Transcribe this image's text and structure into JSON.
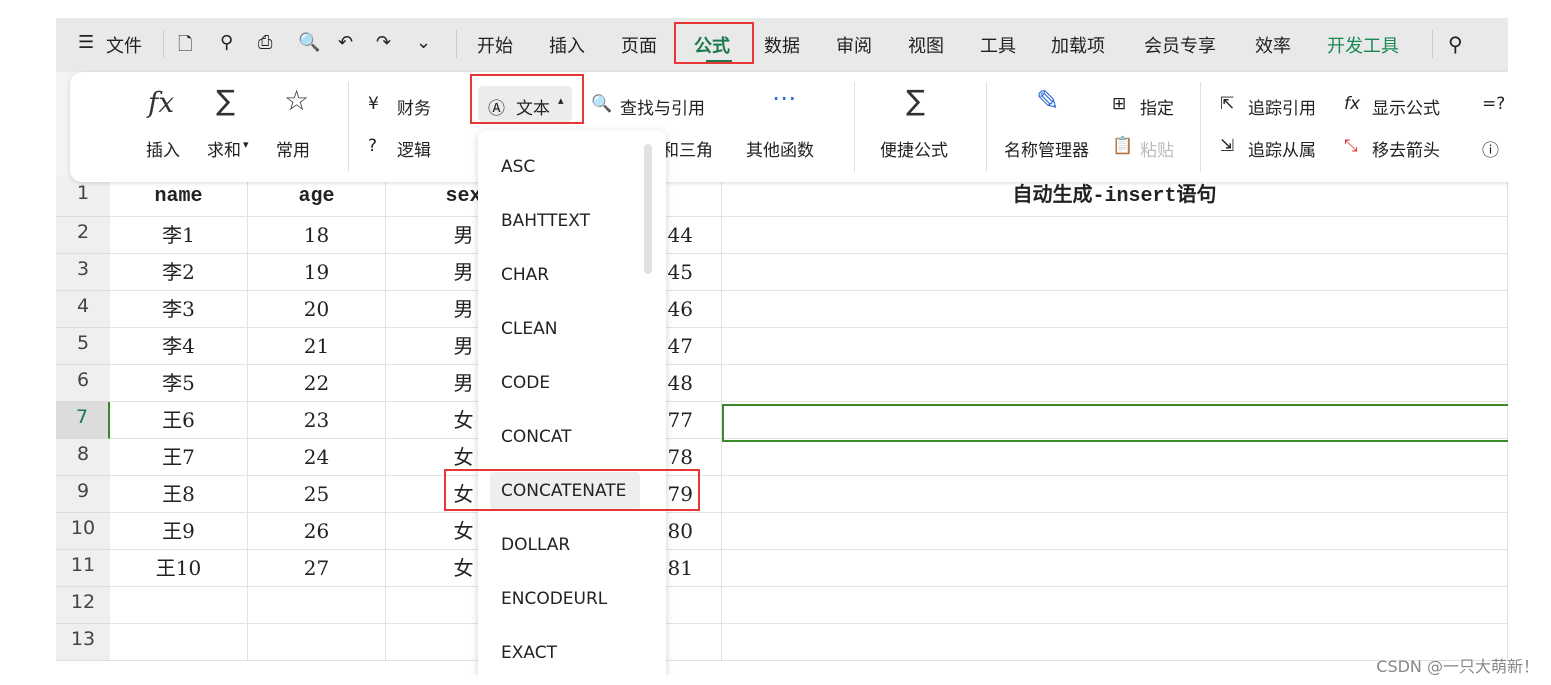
{
  "tabbar": {
    "menu_icon": "hamburger-icon",
    "file": "文件",
    "quick_icons": [
      "save-icon",
      "link-icon",
      "print-icon",
      "print-preview-icon",
      "undo-icon",
      "redo-icon",
      "chevron-down-icon"
    ],
    "tabs": [
      "开始",
      "插入",
      "页面",
      "公式",
      "数据",
      "审阅",
      "视图",
      "工具",
      "加载项",
      "会员专享",
      "效率",
      "开发工具"
    ],
    "active_tab": "公式",
    "search_icon": "search-icon"
  },
  "ribbon": {
    "insert": "插入",
    "sum": "求和",
    "common": "常用",
    "finance": "财务",
    "text": "文本",
    "lookup": "查找与引用",
    "logic": "逻辑",
    "math": "数学和三角",
    "math_visible": "和三角",
    "other": "其他函数",
    "quick_formula": "便捷公式",
    "name_manager": "名称管理器",
    "define": "指定",
    "paste": "粘贴",
    "trace_precedents": "追踪引用",
    "trace_dependents": "追踪从属",
    "show_formulas": "显示公式",
    "remove_arrows": "移去箭头"
  },
  "dropdown": {
    "items": [
      "ASC",
      "BAHTTEXT",
      "CHAR",
      "CLEAN",
      "CODE",
      "CONCAT",
      "CONCATENATE",
      "DOLLAR",
      "ENCODEURL",
      "EXACT"
    ],
    "highlighted": "CONCATENATE"
  },
  "sheet": {
    "row_numbers": [
      "1",
      "2",
      "3",
      "4",
      "5",
      "6",
      "7",
      "8",
      "9",
      "10",
      "11",
      "12",
      "13"
    ],
    "selected_row": "7",
    "headers": [
      "name",
      "age",
      "sex",
      "",
      "自动生成-insert语句"
    ],
    "rows": [
      [
        "李1",
        "18",
        "男",
        "44"
      ],
      [
        "李2",
        "19",
        "男",
        "45"
      ],
      [
        "李3",
        "20",
        "男",
        "46"
      ],
      [
        "李4",
        "21",
        "男",
        "47"
      ],
      [
        "李5",
        "22",
        "男",
        "48"
      ],
      [
        "王6",
        "23",
        "女",
        "77"
      ],
      [
        "王7",
        "24",
        "女",
        "78"
      ],
      [
        "王8",
        "25",
        "女",
        "79"
      ],
      [
        "王9",
        "26",
        "女",
        "80"
      ],
      [
        "王10",
        "27",
        "女",
        "81"
      ]
    ]
  },
  "watermark": "CSDN @一只大萌新！",
  "colors": {
    "accent": "#1a7a4c",
    "highlight_box": "#e83535",
    "selection": "#3a8a2a"
  }
}
